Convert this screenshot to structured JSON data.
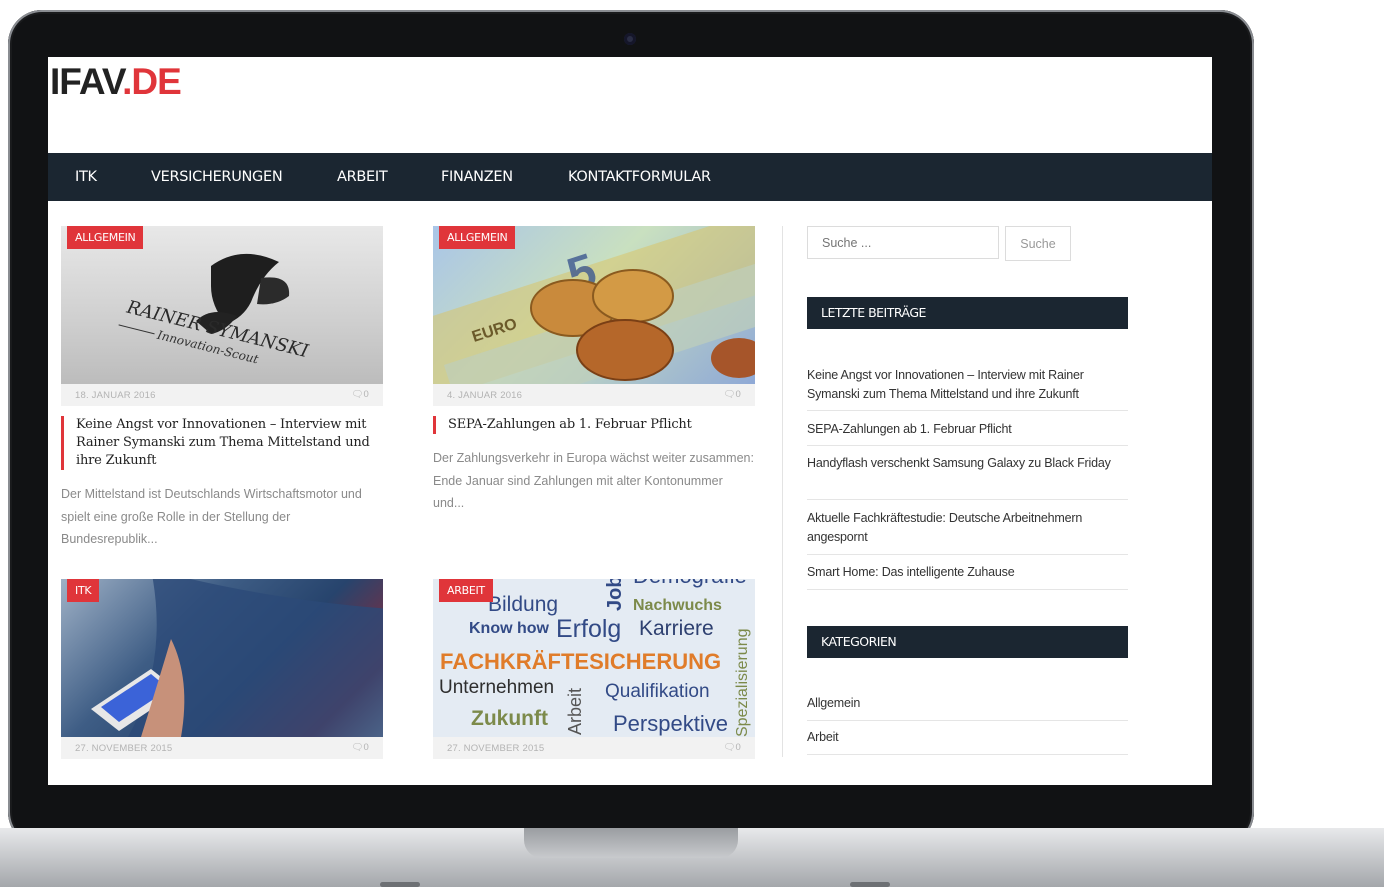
{
  "site": {
    "logo_main": "IFAV",
    "logo_accent": ".DE"
  },
  "nav": [
    "ITK",
    "VERSICHERUNGEN",
    "ARBEIT",
    "FINANZEN",
    "KONTAKTFORMULAR"
  ],
  "posts": [
    {
      "category": "ALLGEMEIN",
      "date": "18. JANUAR 2016",
      "comments": "0",
      "title": "Keine Angst vor Innovationen – Interview mit Rainer Symanski zum Thema Mittelstand und ihre Zukunft",
      "excerpt": "Der Mittelstand ist Deutschlands Wirtschaftsmotor und spielt eine große Rolle in der Stellung der Bundesrepublik...",
      "image_text": {
        "line1": "RAINER SYMANSKI",
        "line2": "Innovation-Scout"
      }
    },
    {
      "category": "ALLGEMEIN",
      "date": "4. JANUAR 2016",
      "comments": "0",
      "title": "SEPA-Zahlungen ab 1. Februar Pflicht",
      "excerpt": "Der Zahlungsverkehr in Europa wächst weiter zusammen: Ende Januar sind Zahlungen mit alter Kontonummer und...",
      "image_text": {
        "note": "5",
        "euro": "EURO"
      }
    },
    {
      "category": "ITK",
      "date": "27. NOVEMBER 2015",
      "comments": "0"
    },
    {
      "category": "ARBEIT",
      "date": "27. NOVEMBER 2015",
      "comments": "0",
      "image_text": {
        "w1": "Bildung",
        "w2": "Nachwuchs",
        "w3": "Know how",
        "w4": "Erfolg",
        "w5": "Karriere",
        "w6": "FACHKRÄFTESICHERUNG",
        "w7": "Unternehmen",
        "w8": "Qualifikation",
        "w9": "Zukunft",
        "w10": "Arbeit",
        "w11": "Perspektive",
        "w12": "Spezialisierung",
        "w13": "Demografie",
        "w14": "Job"
      }
    }
  ],
  "sidebar": {
    "search_placeholder": "Suche ...",
    "search_button": "Suche",
    "recent_title": "LETZTE BEITRÄGE",
    "recent": [
      "Keine Angst vor Innovationen – Interview mit Rainer Symanski zum Thema Mittelstand und ihre Zukunft",
      "SEPA-Zahlungen ab 1. Februar Pflicht",
      "Handyflash verschenkt Samsung Galaxy zu Black Friday",
      "Aktuelle Fachkräftestudie: Deutsche Arbeitnehmern angesporn­t",
      "Smart Home: Das intelligente Zuhause"
    ],
    "categories_title": "KATEGORIEN",
    "categories": [
      "Allgemein",
      "Arbeit"
    ]
  },
  "colors": {
    "accent": "#e0353a",
    "nav_bg": "#1b2631"
  }
}
